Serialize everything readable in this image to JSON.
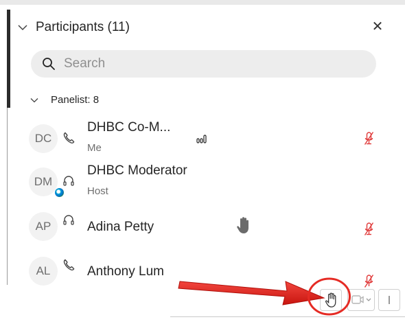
{
  "header": {
    "title": "Participants (11)"
  },
  "search": {
    "placeholder": "Search"
  },
  "section": {
    "label": "Panelist: 8"
  },
  "participants": [
    {
      "initials": "DC",
      "name": "DHBC Co-M...",
      "role": "Me",
      "connection": "phone-icon",
      "muted": true,
      "signal": true,
      "hand_raised": false
    },
    {
      "initials": "DM",
      "name": "DHBC Moderator",
      "role": "Host",
      "connection": "headset-icon",
      "muted": false,
      "hand_raised": false
    },
    {
      "initials": "AP",
      "name": "Adina Petty",
      "role": "",
      "connection": "headset-icon",
      "muted": true,
      "hand_raised": true
    },
    {
      "initials": "AL",
      "name": "Anthony Lum",
      "role": "",
      "connection": "phone-icon",
      "muted": true,
      "hand_raised": false
    }
  ],
  "colors": {
    "mute_red": "#e03a3a",
    "annotation_red": "#e52b24",
    "hand_gray": "#6b6b6b"
  }
}
